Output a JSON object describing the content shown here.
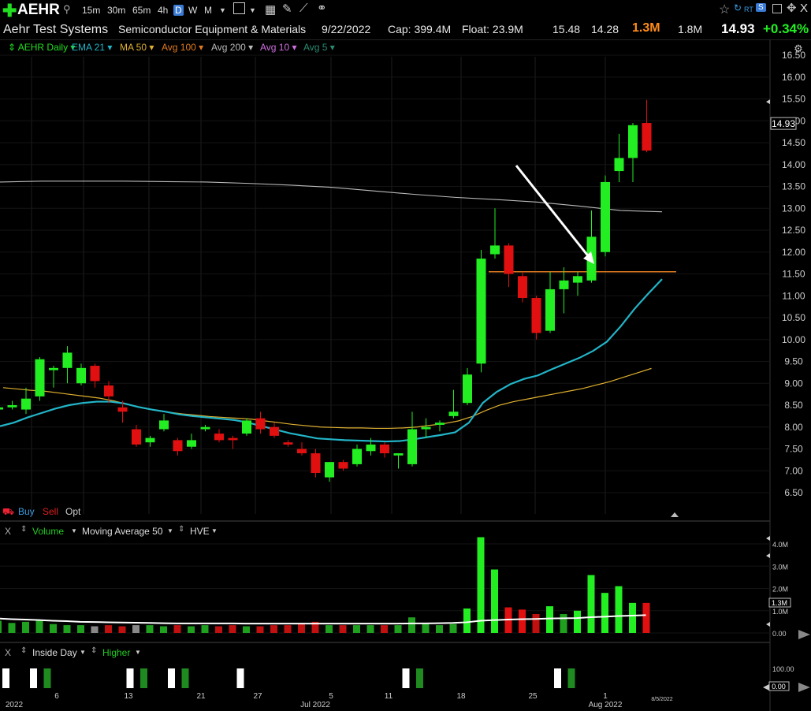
{
  "toolbar": {
    "symbol": "AEHR",
    "timeframes": [
      "15m",
      "30m",
      "65m",
      "4h",
      "D",
      "W",
      "M"
    ],
    "active_timeframe": "D",
    "right_icons": [
      "star-icon",
      "refresh-icon",
      "rt-badge",
      "s-badge",
      "window-icon",
      "pin-icon",
      "close-icon"
    ],
    "rt_label": "RT",
    "s_label": "S",
    "close_label": "X"
  },
  "info": {
    "company": "Aehr Test Systems",
    "industry": "Semiconductor Equipment & Materials",
    "date": "9/22/2022",
    "cap": "Cap: 399.4M",
    "float": "Float: 23.9M",
    "high": "15.48",
    "low": "14.28",
    "volume": "1.3M",
    "avg_volume": "1.8M",
    "last": "14.93",
    "change": "+0.34%"
  },
  "legend": [
    {
      "label": "AEHR Daily",
      "color": "#22dd22"
    },
    {
      "label": "EMA 21",
      "color": "#22b5c8"
    },
    {
      "label": "MA 50",
      "color": "#e0b030"
    },
    {
      "label": "Avg 100",
      "color": "#e07a20"
    },
    {
      "label": "Avg 200",
      "color": "#bbbbbb"
    },
    {
      "label": "Avg 10",
      "color": "#d070e0"
    },
    {
      "label": "Avg 5",
      "color": "#2a8a70"
    }
  ],
  "trade": {
    "buy": "Buy",
    "sell": "Sell",
    "opt": "Opt"
  },
  "volume_panel": {
    "close": "X",
    "title": "Volume",
    "ma": "Moving Average 50",
    "hve": "HVE",
    "last_label": "1.3M"
  },
  "inside_panel": {
    "close": "X",
    "title": "Inside Day",
    "higher": "Higher",
    "last_label": "0.00"
  },
  "colors": {
    "up": "#22ee22",
    "down": "#e01010",
    "grid": "#1e1e1e",
    "ema21": "#22b5c8",
    "ma50": "#e0b030",
    "ma200": "#bbbbbb",
    "level": "#e07a20",
    "arrow": "#ffffff"
  },
  "chart_data": {
    "type": "candlestick",
    "y_ticks": [
      "16.50",
      "16.00",
      "15.50",
      "15.00",
      "14.50",
      "14.00",
      "13.50",
      "13.00",
      "12.50",
      "12.00",
      "11.50",
      "11.00",
      "10.50",
      "10.00",
      "9.50",
      "9.00",
      "8.50",
      "8.00",
      "7.50",
      "7.00",
      "6.50"
    ],
    "ylim": [
      6.25,
      16.75
    ],
    "last_price_label": "14.93",
    "horizontal_level": 11.55,
    "x_labels": [
      "2022",
      "6",
      "13",
      "21",
      "27",
      "Jul 2022",
      "5",
      "11",
      "18",
      "25",
      "Aug 2022",
      "1",
      "8/5/2022"
    ],
    "candles": [
      {
        "o": 8.4,
        "h": 8.55,
        "l": 8.35,
        "c": 8.45
      },
      {
        "o": 8.45,
        "h": 8.6,
        "l": 8.4,
        "c": 8.5
      },
      {
        "o": 8.4,
        "h": 8.9,
        "l": 8.3,
        "c": 8.65
      },
      {
        "o": 8.7,
        "h": 9.6,
        "l": 8.6,
        "c": 9.55
      },
      {
        "o": 9.3,
        "h": 9.4,
        "l": 8.9,
        "c": 9.35
      },
      {
        "o": 9.35,
        "h": 9.85,
        "l": 9.0,
        "c": 9.7
      },
      {
        "o": 9.0,
        "h": 9.45,
        "l": 8.95,
        "c": 9.35
      },
      {
        "o": 9.4,
        "h": 9.45,
        "l": 8.9,
        "c": 9.05
      },
      {
        "o": 8.95,
        "h": 9.05,
        "l": 8.55,
        "c": 8.7
      },
      {
        "o": 8.45,
        "h": 8.6,
        "l": 8.1,
        "c": 8.35
      },
      {
        "o": 7.95,
        "h": 8.05,
        "l": 7.55,
        "c": 7.6
      },
      {
        "o": 7.65,
        "h": 7.8,
        "l": 7.55,
        "c": 7.75
      },
      {
        "o": 7.95,
        "h": 8.3,
        "l": 7.9,
        "c": 8.15
      },
      {
        "o": 7.7,
        "h": 7.75,
        "l": 7.35,
        "c": 7.45
      },
      {
        "o": 7.55,
        "h": 7.85,
        "l": 7.5,
        "c": 7.7
      },
      {
        "o": 7.95,
        "h": 8.05,
        "l": 7.9,
        "c": 8.0
      },
      {
        "o": 7.85,
        "h": 7.95,
        "l": 7.65,
        "c": 7.7
      },
      {
        "o": 7.75,
        "h": 7.8,
        "l": 7.5,
        "c": 7.7
      },
      {
        "o": 7.85,
        "h": 8.2,
        "l": 7.8,
        "c": 8.15
      },
      {
        "o": 8.2,
        "h": 8.35,
        "l": 7.85,
        "c": 7.95
      },
      {
        "o": 8.0,
        "h": 8.1,
        "l": 7.75,
        "c": 7.8
      },
      {
        "o": 7.65,
        "h": 7.7,
        "l": 7.55,
        "c": 7.6
      },
      {
        "o": 7.5,
        "h": 7.65,
        "l": 7.35,
        "c": 7.4
      },
      {
        "o": 7.4,
        "h": 7.5,
        "l": 6.85,
        "c": 6.95
      },
      {
        "o": 6.85,
        "h": 7.2,
        "l": 6.75,
        "c": 7.2
      },
      {
        "o": 7.2,
        "h": 7.25,
        "l": 7.0,
        "c": 7.05
      },
      {
        "o": 7.15,
        "h": 7.6,
        "l": 7.1,
        "c": 7.5
      },
      {
        "o": 7.45,
        "h": 7.75,
        "l": 7.35,
        "c": 7.6
      },
      {
        "o": 7.6,
        "h": 7.65,
        "l": 7.3,
        "c": 7.4
      },
      {
        "o": 7.35,
        "h": 7.4,
        "l": 7.05,
        "c": 7.4
      },
      {
        "o": 7.15,
        "h": 8.35,
        "l": 7.1,
        "c": 7.95
      },
      {
        "o": 7.95,
        "h": 8.2,
        "l": 7.75,
        "c": 8.0
      },
      {
        "o": 8.05,
        "h": 8.15,
        "l": 7.9,
        "c": 8.1
      },
      {
        "o": 8.25,
        "h": 8.85,
        "l": 8.2,
        "c": 8.35
      },
      {
        "o": 8.55,
        "h": 9.35,
        "l": 8.5,
        "c": 9.2
      },
      {
        "o": 9.45,
        "h": 12.05,
        "l": 9.25,
        "c": 11.85
      },
      {
        "o": 11.95,
        "h": 13.0,
        "l": 11.85,
        "c": 12.15
      },
      {
        "o": 12.15,
        "h": 12.2,
        "l": 11.2,
        "c": 11.5
      },
      {
        "o": 11.45,
        "h": 11.55,
        "l": 10.85,
        "c": 10.95
      },
      {
        "o": 10.95,
        "h": 11.0,
        "l": 10.0,
        "c": 10.15
      },
      {
        "o": 10.2,
        "h": 11.55,
        "l": 10.15,
        "c": 11.15
      },
      {
        "o": 11.15,
        "h": 11.65,
        "l": 10.6,
        "c": 11.35
      },
      {
        "o": 11.3,
        "h": 11.55,
        "l": 11.0,
        "c": 11.45
      },
      {
        "o": 11.35,
        "h": 12.95,
        "l": 11.3,
        "c": 12.35
      },
      {
        "o": 12.0,
        "h": 13.75,
        "l": 11.9,
        "c": 13.6
      },
      {
        "o": 13.85,
        "h": 14.7,
        "l": 13.6,
        "c": 14.15
      },
      {
        "o": 14.15,
        "h": 14.95,
        "l": 13.6,
        "c": 14.9
      },
      {
        "o": 14.95,
        "h": 15.48,
        "l": 14.28,
        "c": 14.32
      }
    ],
    "ema21": [
      8.02,
      8.1,
      8.22,
      8.32,
      8.42,
      8.5,
      8.55,
      8.58,
      8.58,
      8.54,
      8.46,
      8.4,
      8.35,
      8.29,
      8.25,
      8.22,
      8.19,
      8.16,
      8.1,
      8.02,
      7.94,
      7.86,
      7.8,
      7.74,
      7.72,
      7.7,
      7.69,
      7.68,
      7.67,
      7.68,
      7.72,
      7.77,
      7.82,
      7.88,
      8.1,
      8.55,
      8.8,
      8.98,
      9.1,
      9.18,
      9.32,
      9.45,
      9.58,
      9.74,
      9.95,
      10.3,
      10.7,
      11.05,
      11.38
    ],
    "ma50": [
      8.9,
      8.87,
      8.84,
      8.82,
      8.78,
      8.74,
      8.7,
      8.66,
      8.6,
      8.52,
      8.44,
      8.38,
      8.34,
      8.3,
      8.27,
      8.24,
      8.22,
      8.2,
      8.18,
      8.14,
      8.1,
      8.06,
      8.03,
      8.0,
      7.99,
      7.98,
      7.98,
      7.97,
      7.97,
      7.98,
      8.0,
      8.04,
      8.08,
      8.14,
      8.24,
      8.38,
      8.5,
      8.58,
      8.64,
      8.7,
      8.76,
      8.82,
      8.88,
      8.96,
      9.04,
      9.14,
      9.24,
      9.34
    ],
    "ma200": [
      13.6,
      13.62,
      13.62,
      13.62,
      13.61,
      13.6,
      13.57,
      13.53,
      13.48,
      13.4,
      13.32,
      13.25,
      13.2,
      13.14,
      13.05,
      12.95,
      12.92
    ],
    "volume_ylim": [
      0,
      4.2
    ],
    "volume_ticks": [
      "4.0M",
      "3.0M",
      "2.0M",
      "1.0M",
      "0.00"
    ],
    "volumes": [
      0.55,
      0.45,
      0.5,
      0.55,
      0.4,
      0.35,
      0.35,
      0.3,
      0.35,
      0.3,
      0.35,
      0.35,
      0.3,
      0.35,
      0.3,
      0.35,
      0.3,
      0.35,
      0.3,
      0.3,
      0.35,
      0.35,
      0.4,
      0.5,
      0.35,
      0.35,
      0.35,
      0.35,
      0.35,
      0.35,
      0.7,
      0.4,
      0.35,
      0.4,
      1.1,
      4.3,
      2.85,
      1.15,
      1.05,
      0.85,
      1.2,
      0.85,
      1.0,
      2.6,
      1.8,
      2.1,
      1.35,
      1.35
    ],
    "volume_ma": [
      0.65,
      0.62,
      0.6,
      0.58,
      0.55,
      0.53,
      0.5,
      0.49,
      0.48,
      0.47,
      0.46,
      0.45,
      0.44,
      0.43,
      0.43,
      0.43,
      0.43,
      0.43,
      0.42,
      0.42,
      0.42,
      0.42,
      0.42,
      0.42,
      0.42,
      0.42,
      0.42,
      0.42,
      0.42,
      0.42,
      0.43,
      0.43,
      0.44,
      0.45,
      0.48,
      0.55,
      0.58,
      0.6,
      0.62,
      0.63,
      0.65,
      0.66,
      0.67,
      0.71,
      0.73,
      0.76,
      0.78,
      0.8
    ],
    "inside_ylim": [
      0,
      100
    ],
    "inside_ticks": [
      "100.00",
      "0.00"
    ],
    "inside_day_bars": [
      {
        "i": 0,
        "kind": "white"
      },
      {
        "i": 2,
        "kind": "white"
      },
      {
        "i": 3,
        "kind": "green"
      },
      {
        "i": 9,
        "kind": "white"
      },
      {
        "i": 10,
        "kind": "green"
      },
      {
        "i": 12,
        "kind": "white"
      },
      {
        "i": 13,
        "kind": "green"
      },
      {
        "i": 17,
        "kind": "white"
      },
      {
        "i": 29,
        "kind": "white"
      },
      {
        "i": 30,
        "kind": "green"
      },
      {
        "i": 40,
        "kind": "white"
      },
      {
        "i": 41,
        "kind": "green"
      }
    ]
  }
}
